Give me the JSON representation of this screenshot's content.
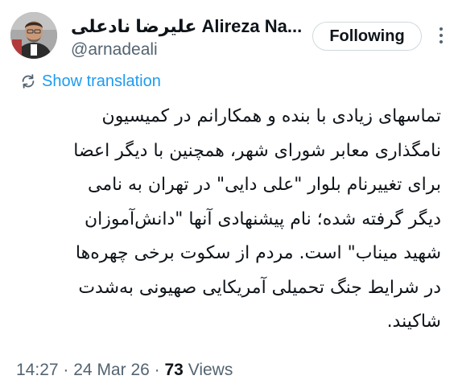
{
  "author": {
    "display_name": "علیرضا نادعلی Alireza Na...",
    "handle": "@arnadeali"
  },
  "follow_button": {
    "label": "Following"
  },
  "translate": {
    "label": "Show translation"
  },
  "tweet": {
    "lines": [
      "تماسهای زیادی با بنده و همکارانم در کمیسیون",
      "نامگذاری معابر شورای شهر، همچنین با دیگر اعضا",
      "برای تغییرنام بلوار \"علی دایی\" در تهران به نامی",
      "دیگر گرفته شده؛ نام پیشنهادی آنها \"دانش‌آموزان",
      "شهید میناب\" است. مردم از سکوت برخی چهره‌ها",
      "در شرایط جنگ تحمیلی آمریکایی صهیونی به‌شدت",
      "شاکیند."
    ]
  },
  "meta": {
    "time": "14:27",
    "date": "24 Mar 26",
    "views_count": "73",
    "views_label": "Views",
    "separator": "·"
  },
  "icons": {
    "more": "more-dots-icon",
    "translate": "translate-icon"
  }
}
